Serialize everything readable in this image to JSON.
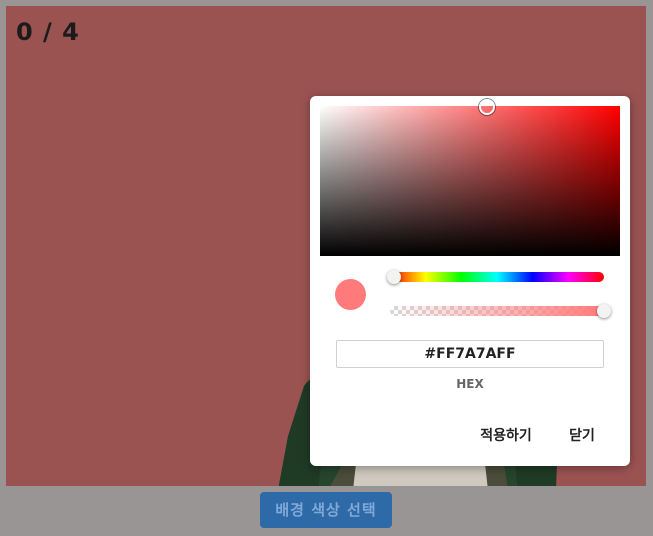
{
  "counter": {
    "text": "0 / 4"
  },
  "canvas": {
    "background_color": "#9b5352"
  },
  "bottom_button": {
    "label": "배경 색상 선택",
    "color": "#2f6aa8"
  },
  "color_picker": {
    "hue_color": "#ff0000",
    "hue": 0,
    "alpha": 1.0,
    "hex_value": "#FF7A7AFF",
    "hex_label": "HEX",
    "preview_color": "#ff7a7a",
    "apply_label": "적용하기",
    "close_label": "닫기"
  }
}
